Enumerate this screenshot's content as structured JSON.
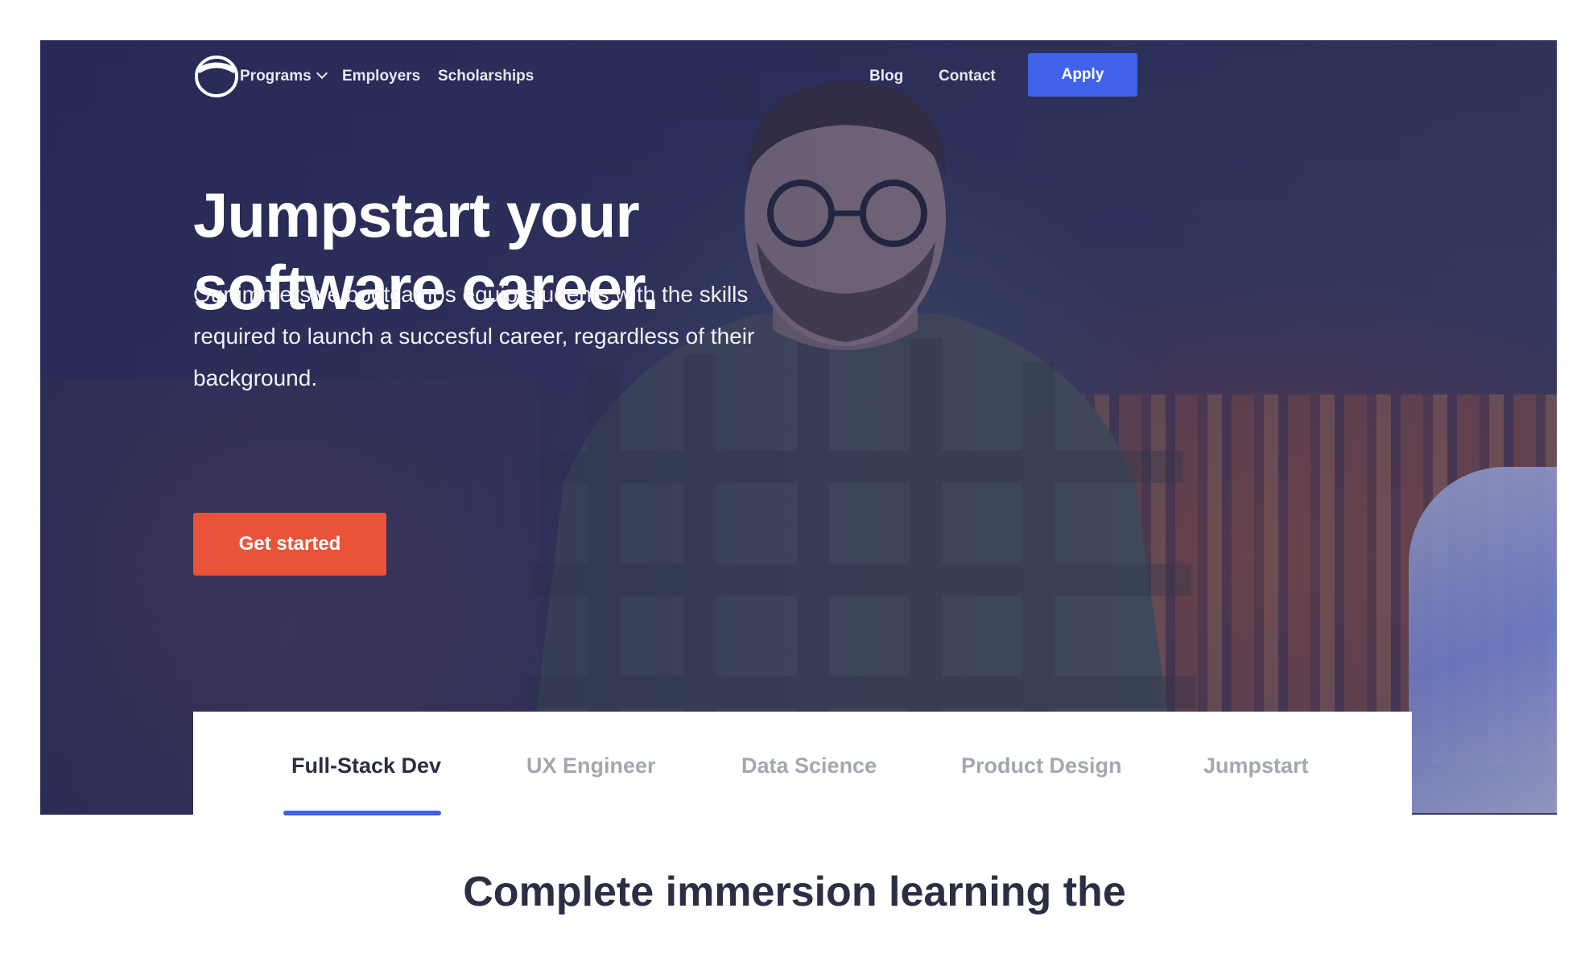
{
  "nav": {
    "logo_icon": "ring-logo-icon",
    "programs_label": "Programs",
    "programs_icon": "chevron-down-icon",
    "employers_label": "Employers",
    "scholarships_label": "Scholarships",
    "blog_label": "Blog",
    "contact_label": "Contact",
    "apply_label": "Apply"
  },
  "hero": {
    "headline_line1": "Jumpstart your",
    "headline_line2": "software career.",
    "subtext": "Our immersive bootcamps equip students with the skills required to launch a succesful career, regardless of their background.",
    "cta_label": "Get started"
  },
  "tabs": {
    "items": [
      {
        "label": "Full-Stack Dev",
        "active": true
      },
      {
        "label": "UX Engineer",
        "active": false
      },
      {
        "label": "Data Science",
        "active": false
      },
      {
        "label": "Product Design",
        "active": false
      },
      {
        "label": "Jumpstart",
        "active": false
      }
    ]
  },
  "section": {
    "heading": "Complete immersion learning the"
  },
  "colors": {
    "accent_blue": "#3f62e8",
    "cta_orange": "#e8533a",
    "hero_overlay": "#2d3158",
    "tab_active": "#2a2e42",
    "tab_inactive": "#a3a7b3"
  }
}
